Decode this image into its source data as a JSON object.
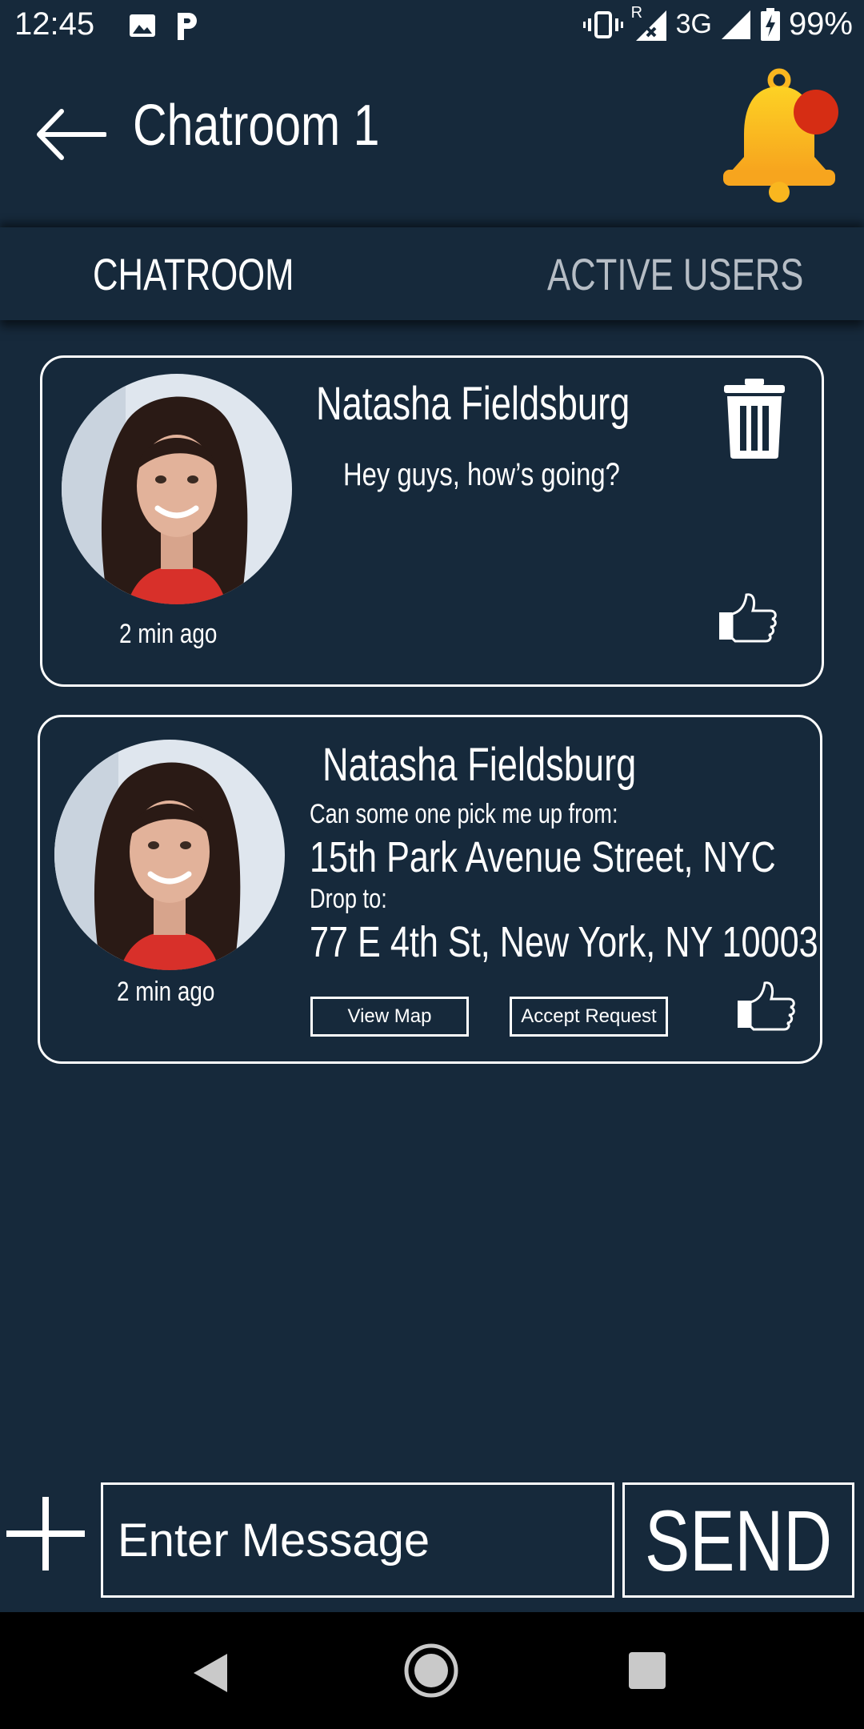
{
  "status_bar": {
    "time": "12:45",
    "network": "3G",
    "roaming": "R",
    "battery": "99%"
  },
  "header": {
    "title": "Chatroom 1",
    "back_icon": "arrow-left-icon",
    "notification_icon": "bell-icon"
  },
  "tabs": [
    {
      "label": "CHATROOM",
      "active": true
    },
    {
      "label": "ACTIVE USERS",
      "active": false
    }
  ],
  "messages": [
    {
      "user": "Natasha Fieldsburg",
      "text": "Hey guys, how’s going?",
      "time_ago": "2 min ago"
    },
    {
      "user": "Natasha Fieldsburg",
      "pickup_prompt": "Can some one pick me up from:",
      "pickup_location": "15th Park Avenue Street, NYC",
      "drop_prompt": "Drop to:",
      "drop_location": "77 E 4th St, New York, NY 10003",
      "time_ago": "2 min ago",
      "view_map_label": "View Map",
      "accept_label": "Accept Request"
    }
  ],
  "composer": {
    "placeholder": "Enter Message",
    "send_label": "SEND"
  },
  "colors": {
    "background": "#16293b",
    "bell": "#fbbf1a",
    "notification_dot": "#d62d14"
  }
}
